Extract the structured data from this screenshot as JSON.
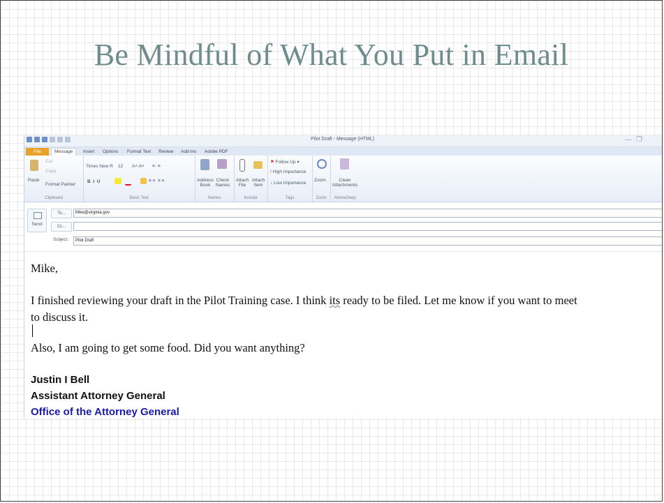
{
  "slide": {
    "title": "Be Mindful of What You Put in Email"
  },
  "window": {
    "title": "Pilot Draft - Message (HTML)"
  },
  "ribbon": {
    "tabs": [
      "File",
      "Message",
      "Insert",
      "Options",
      "Format Text",
      "Review",
      "Add-Ins",
      "Adobe PDF"
    ],
    "clipboard": {
      "paste": "Paste",
      "cut": "Cut",
      "copy": "Copy",
      "format_painter": "Format Painter",
      "label": "Clipboard"
    },
    "basic_text": {
      "font": "Times New R",
      "size": "12",
      "label": "Basic Text"
    },
    "names": {
      "address_book": "Address Book",
      "check_names": "Check Names",
      "label": "Names"
    },
    "include": {
      "attach_file": "Attach File",
      "attach_item": "Attach Item",
      "label": "Include"
    },
    "tags": {
      "follow_up": "Follow Up",
      "high_importance": "High Importance",
      "low_importance": "Low Importance",
      "label": "Tags"
    },
    "zoom": {
      "zoom": "Zoom",
      "label": "Zoom"
    },
    "attachments": {
      "clean": "Clean Attachments",
      "label": "AboveDeep"
    }
  },
  "header": {
    "send": "Send",
    "to_button": "To...",
    "to_value": "Mike@virginia.gov",
    "cc_button": "Cc...",
    "cc_value": "",
    "subject_label": "Subject:",
    "subject_value": "Pilot Draft"
  },
  "message": {
    "greeting": "Mike,",
    "para1_line1_pre": "I finished reviewing your draft in the Pilot Training case.  I think ",
    "para1_its": "its",
    "para1_line1_post": " ready to be filed.  Let me know if you want to meet",
    "para1_line2": "to discuss it.",
    "para2": "Also, I am going to get some food.  Did you want anything?",
    "sig_name": "Justin I Bell",
    "sig_title": "Assistant Attorney General",
    "sig_office": "Office of the Attorney General"
  },
  "colors": {
    "title": "#6f8c8c",
    "file_tab": "#e8a228",
    "link_blue": "#1a1aa8"
  }
}
